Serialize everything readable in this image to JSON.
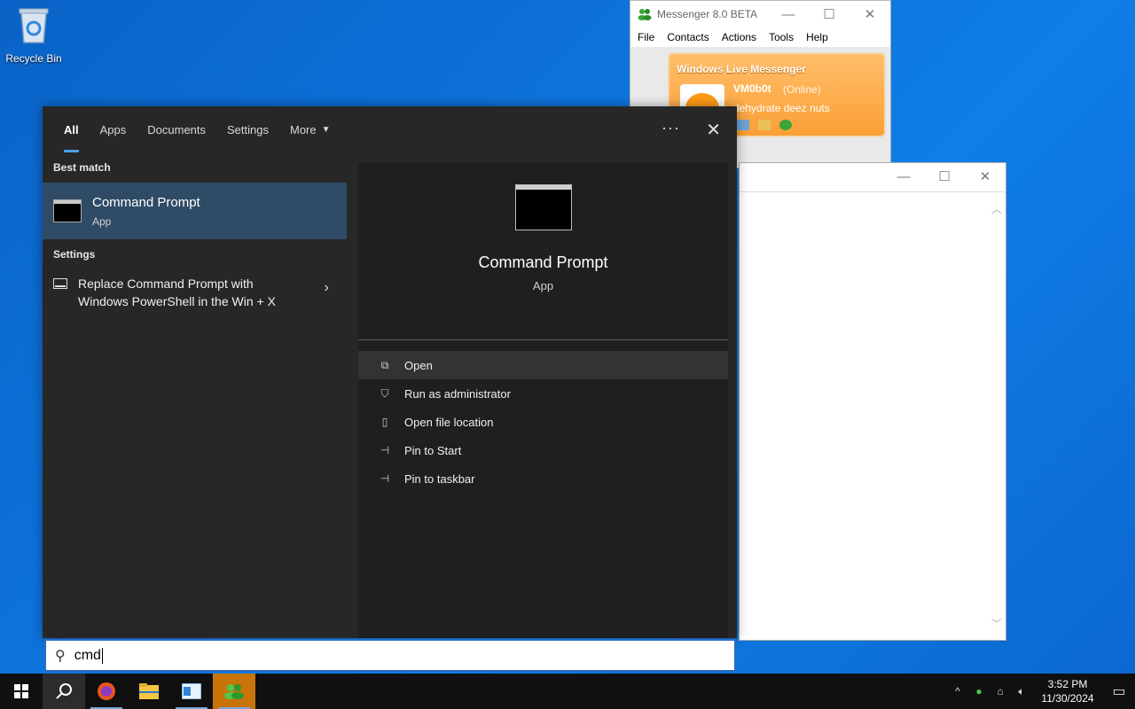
{
  "desktop": {
    "recycle_bin_label": "Recycle Bin"
  },
  "messenger": {
    "title": "Messenger 8.0 BETA",
    "menu": [
      "File",
      "Contacts",
      "Actions",
      "Tools",
      "Help"
    ],
    "brand": "Windows Live Messenger",
    "username": "VM0b0t",
    "status": "(Online)",
    "personal_message": "dehydrate deez nuts",
    "accent": "#fb9f35"
  },
  "search": {
    "tabs": [
      "All",
      "Apps",
      "Documents",
      "Settings",
      "More"
    ],
    "active_tab": "All",
    "best_match_header": "Best match",
    "best_match": {
      "title": "Command Prompt",
      "subtitle": "App"
    },
    "settings_header": "Settings",
    "settings_item": "Replace Command Prompt with Windows PowerShell in the Win + X",
    "detail": {
      "title": "Command Prompt",
      "subtitle": "App"
    },
    "actions": [
      {
        "label": "Open",
        "icon": "open-icon"
      },
      {
        "label": "Run as administrator",
        "icon": "shield-icon"
      },
      {
        "label": "Open file location",
        "icon": "file-location-icon"
      },
      {
        "label": "Pin to Start",
        "icon": "pin-icon"
      },
      {
        "label": "Pin to taskbar",
        "icon": "pin-icon"
      }
    ],
    "query": "cmd",
    "accent": "#4aa0ea"
  },
  "taskbar": {
    "time": "3:52 PM",
    "date": "11/30/2024"
  }
}
